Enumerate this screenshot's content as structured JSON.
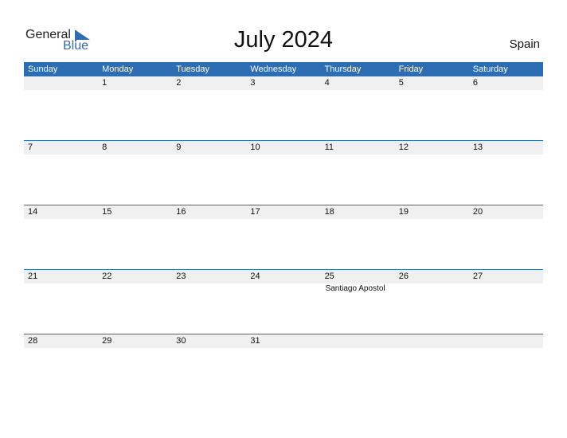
{
  "logo": {
    "line1": "General",
    "line2": "Blue"
  },
  "title": "July 2024",
  "country": "Spain",
  "colors": {
    "accent": "#2d6db4",
    "strip": "#f0f0f0"
  },
  "weekdays": [
    "Sunday",
    "Monday",
    "Tuesday",
    "Wednesday",
    "Thursday",
    "Friday",
    "Saturday"
  ],
  "weeks": [
    [
      "",
      "1",
      "2",
      "3",
      "4",
      "5",
      "6"
    ],
    [
      "7",
      "8",
      "9",
      "10",
      "11",
      "12",
      "13"
    ],
    [
      "14",
      "15",
      "16",
      "17",
      "18",
      "19",
      "20"
    ],
    [
      "21",
      "22",
      "23",
      "24",
      "25",
      "26",
      "27"
    ],
    [
      "28",
      "29",
      "30",
      "31",
      "",
      "",
      ""
    ]
  ],
  "holidays": [
    {
      "week": 3,
      "day": 4,
      "name": "Santiago Apostol"
    }
  ]
}
